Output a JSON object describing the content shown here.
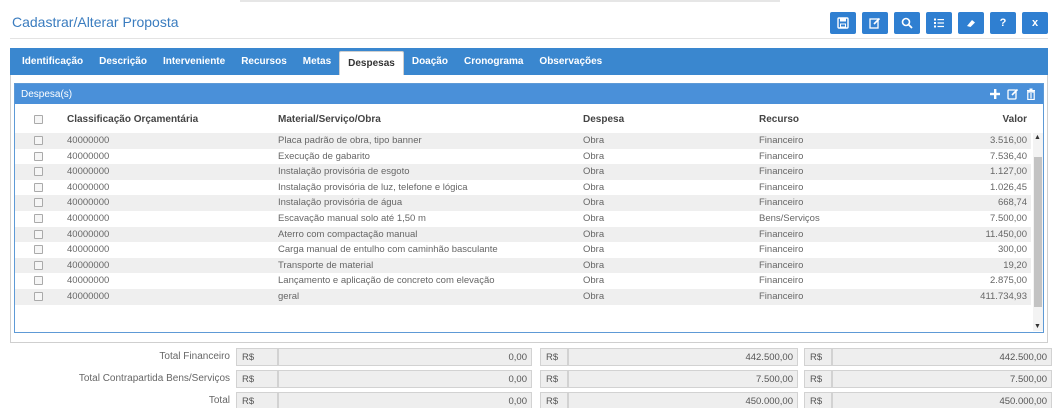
{
  "header": {
    "title": "Cadastrar/Alterar Proposta",
    "toolbar_icons": [
      "save-icon",
      "edit-icon",
      "search-icon",
      "list-icon",
      "eraser-icon",
      "help-icon",
      "close-icon"
    ],
    "help_label": "?",
    "close_label": "x"
  },
  "tabs": [
    {
      "label": "Identificação"
    },
    {
      "label": "Descrição"
    },
    {
      "label": "Interveniente"
    },
    {
      "label": "Recursos"
    },
    {
      "label": "Metas"
    },
    {
      "label": "Despesas"
    },
    {
      "label": "Doação"
    },
    {
      "label": "Cronograma"
    },
    {
      "label": "Observações"
    }
  ],
  "active_tab": "Despesas",
  "panel": {
    "title": "Despesa(s)",
    "icons": [
      "add-icon",
      "edit-icon",
      "trash-icon"
    ]
  },
  "table": {
    "headers": {
      "classificacao": "Classificação Orçamentária",
      "material": "Material/Serviço/Obra",
      "despesa": "Despesa",
      "recurso": "Recurso",
      "valor": "Valor"
    },
    "rows": [
      {
        "classificacao": "40000000",
        "material": "Placa padrão de obra, tipo banner",
        "despesa": "Obra",
        "recurso": "Financeiro",
        "valor": "3.516,00"
      },
      {
        "classificacao": "40000000",
        "material": "Execução de gabarito",
        "despesa": "Obra",
        "recurso": "Financeiro",
        "valor": "7.536,40"
      },
      {
        "classificacao": "40000000",
        "material": "Instalação provisória de esgoto",
        "despesa": "Obra",
        "recurso": "Financeiro",
        "valor": "1.127,00"
      },
      {
        "classificacao": "40000000",
        "material": "Instalação provisória de luz, telefone e lógica",
        "despesa": "Obra",
        "recurso": "Financeiro",
        "valor": "1.026,45"
      },
      {
        "classificacao": "40000000",
        "material": "Instalação provisória de água",
        "despesa": "Obra",
        "recurso": "Financeiro",
        "valor": "668,74"
      },
      {
        "classificacao": "40000000",
        "material": "Escavação manual solo até 1,50 m",
        "despesa": "Obra",
        "recurso": "Bens/Serviços",
        "valor": "7.500,00"
      },
      {
        "classificacao": "40000000",
        "material": "Aterro com compactação manual",
        "despesa": "Obra",
        "recurso": "Financeiro",
        "valor": "11.450,00"
      },
      {
        "classificacao": "40000000",
        "material": "Carga manual de entulho com caminhão basculante",
        "despesa": "Obra",
        "recurso": "Financeiro",
        "valor": "300,00"
      },
      {
        "classificacao": "40000000",
        "material": "Transporte de material",
        "despesa": "Obra",
        "recurso": "Financeiro",
        "valor": "19,20"
      },
      {
        "classificacao": "40000000",
        "material": "Lançamento e aplicação de concreto com elevação",
        "despesa": "Obra",
        "recurso": "Financeiro",
        "valor": "2.875,00"
      },
      {
        "classificacao": "40000000",
        "material": "geral",
        "despesa": "Obra",
        "recurso": "Financeiro",
        "valor": "411.734,93"
      }
    ]
  },
  "totals": [
    {
      "label": "Total Financeiro",
      "cur": "R$",
      "v1": "0,00",
      "v2": "442.500,00",
      "v3": "442.500,00"
    },
    {
      "label": "Total Contrapartida Bens/Serviços",
      "cur": "R$",
      "v1": "0,00",
      "v2": "7.500,00",
      "v3": "7.500,00"
    },
    {
      "label": "Total",
      "cur": "R$",
      "v1": "0,00",
      "v2": "450.000,00",
      "v3": "450.000,00"
    }
  ]
}
